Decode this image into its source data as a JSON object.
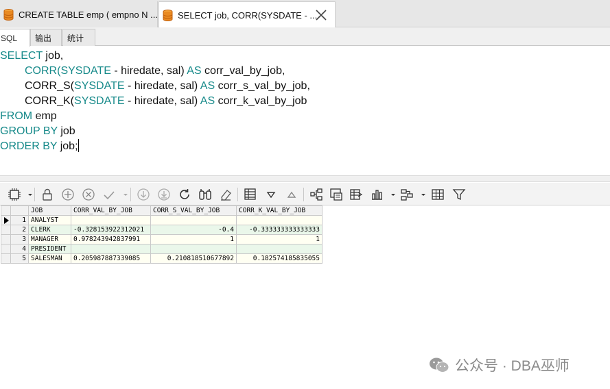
{
  "doc_tabs": [
    {
      "label": "CREATE TABLE emp ( empno N ...",
      "icon": "database-icon",
      "active": false
    },
    {
      "label": "SELECT job, CORR(SYSDATE - ...",
      "icon": "database-icon",
      "active": true
    }
  ],
  "sub_tabs": [
    {
      "label": "SQL",
      "active": true
    },
    {
      "label": "输出",
      "active": false
    },
    {
      "label": "统计",
      "active": false
    }
  ],
  "sql": {
    "line1_kw": "SELECT",
    "line1_txt": " job,",
    "line2_fn": "CORR(",
    "line2_kw": "SYSDATE",
    "line2_txt": " - hiredate, sal) ",
    "line2_as": "AS",
    "line2_alias": " corr_val_by_job,",
    "line3_fn": "CORR_S(",
    "line3_kw": "SYSDATE",
    "line3_txt": " - hiredate, sal) ",
    "line3_as": "AS",
    "line3_alias": " corr_s_val_by_job,",
    "line4_fn": "CORR_K(",
    "line4_kw": "SYSDATE",
    "line4_txt": " - hiredate, sal) ",
    "line4_as": "AS",
    "line4_alias": " corr_k_val_by_job",
    "line5_kw": "FROM",
    "line5_txt": " emp",
    "line6_kw": "GROUP BY",
    "line6_txt": " job",
    "line7_kw": "ORDER BY",
    "line7_txt": " job;"
  },
  "grid": {
    "headers": [
      "JOB",
      "CORR_VAL_BY_JOB",
      "CORR_S_VAL_BY_JOB",
      "CORR_K_VAL_BY_JOB"
    ],
    "rows": [
      {
        "no": "1",
        "job": "ANALYST",
        "v1": "",
        "v2": "",
        "v3": ""
      },
      {
        "no": "2",
        "job": "CLERK",
        "v1": "-0.328153922312021",
        "v2": "-0.4",
        "v3": "-0.333333333333333"
      },
      {
        "no": "3",
        "job": "MANAGER",
        "v1": "0.978243942837991",
        "v2": "1",
        "v3": "1"
      },
      {
        "no": "4",
        "job": "PRESIDENT",
        "v1": "",
        "v2": "",
        "v3": ""
      },
      {
        "no": "5",
        "job": "SALESMAN",
        "v1": "0.205987887339085",
        "v2": "0.210818510677892",
        "v3": "0.182574185835055"
      }
    ]
  },
  "watermark": {
    "text": "公众号 · DBA巫师",
    "icon": "wechat-icon"
  },
  "colors": {
    "keyword": "#178a8a",
    "row_odd": "#fffff2",
    "row_even": "#eaf7ea",
    "tab_icon": "#e07b1a"
  }
}
